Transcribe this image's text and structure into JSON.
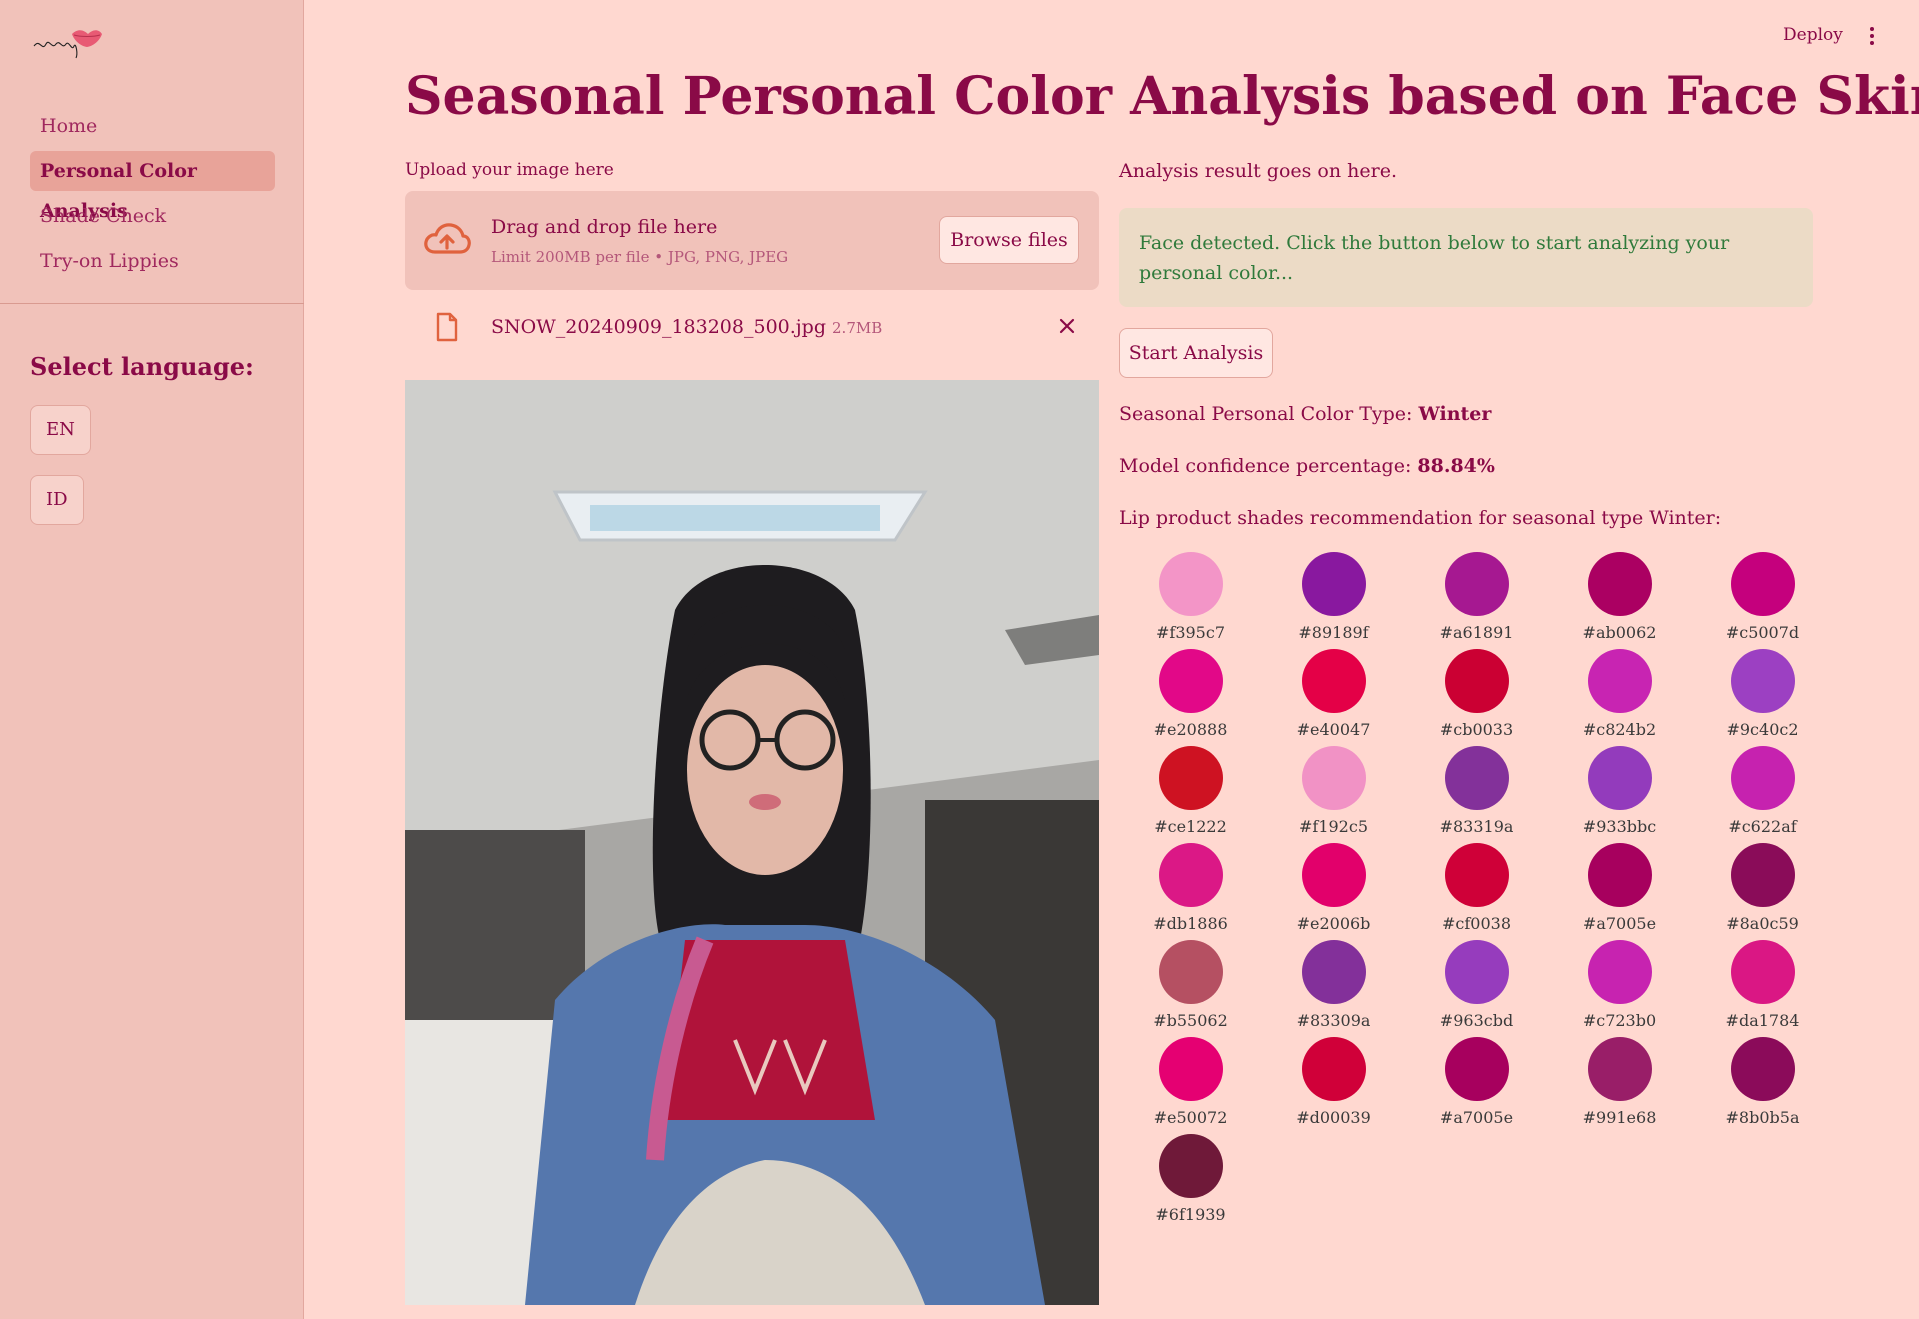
{
  "app": {
    "deploy_label": "Deploy",
    "title": "Seasonal Personal Color Analysis based on Face Skin"
  },
  "sidebar": {
    "nav": [
      "Home",
      "Personal Color Analysis",
      "Shade Check",
      "Try-on Lippies"
    ],
    "active_index": 1,
    "language_title": "Select language:",
    "languages": [
      "EN",
      "ID"
    ]
  },
  "upload": {
    "label": "Upload your image here",
    "drop_title": "Drag and drop file here",
    "drop_hint": "Limit 200MB per file • JPG, PNG, JPEG",
    "browse_label": "Browse files",
    "file_name": "SNOW_20240909_183208_500.jpg",
    "file_size": "2.7MB"
  },
  "result": {
    "label": "Analysis result goes on here.",
    "alert": "Face detected. Click the button below to start analyzing your personal color...",
    "start_label": "Start Analysis",
    "type_label": "Seasonal Personal Color Type: ",
    "type_value": "Winter",
    "confidence_label": "Model confidence percentage: ",
    "confidence_value": "88.84%",
    "recommendation_label": "Lip product shades recommendation for seasonal type Winter:"
  },
  "swatches": [
    "#f395c7",
    "#89189f",
    "#a61891",
    "#ab0062",
    "#c5007d",
    "#e20888",
    "#e40047",
    "#cb0033",
    "#c824b2",
    "#9c40c2",
    "#ce1222",
    "#f192c5",
    "#83319a",
    "#933bbc",
    "#c622af",
    "#db1886",
    "#e2006b",
    "#cf0038",
    "#a7005e",
    "#8a0c59",
    "#b55062",
    "#83309a",
    "#963cbd",
    "#c723b0",
    "#da1784",
    "#e50072",
    "#d00039",
    "#a7005e",
    "#991e68",
    "#8b0b5a",
    "#6f1939"
  ],
  "colors": {
    "background": "#ffd8d0",
    "sidebar": "#f1c2ba",
    "accent": "#8a0a47",
    "success_text": "#2f7a3b"
  }
}
